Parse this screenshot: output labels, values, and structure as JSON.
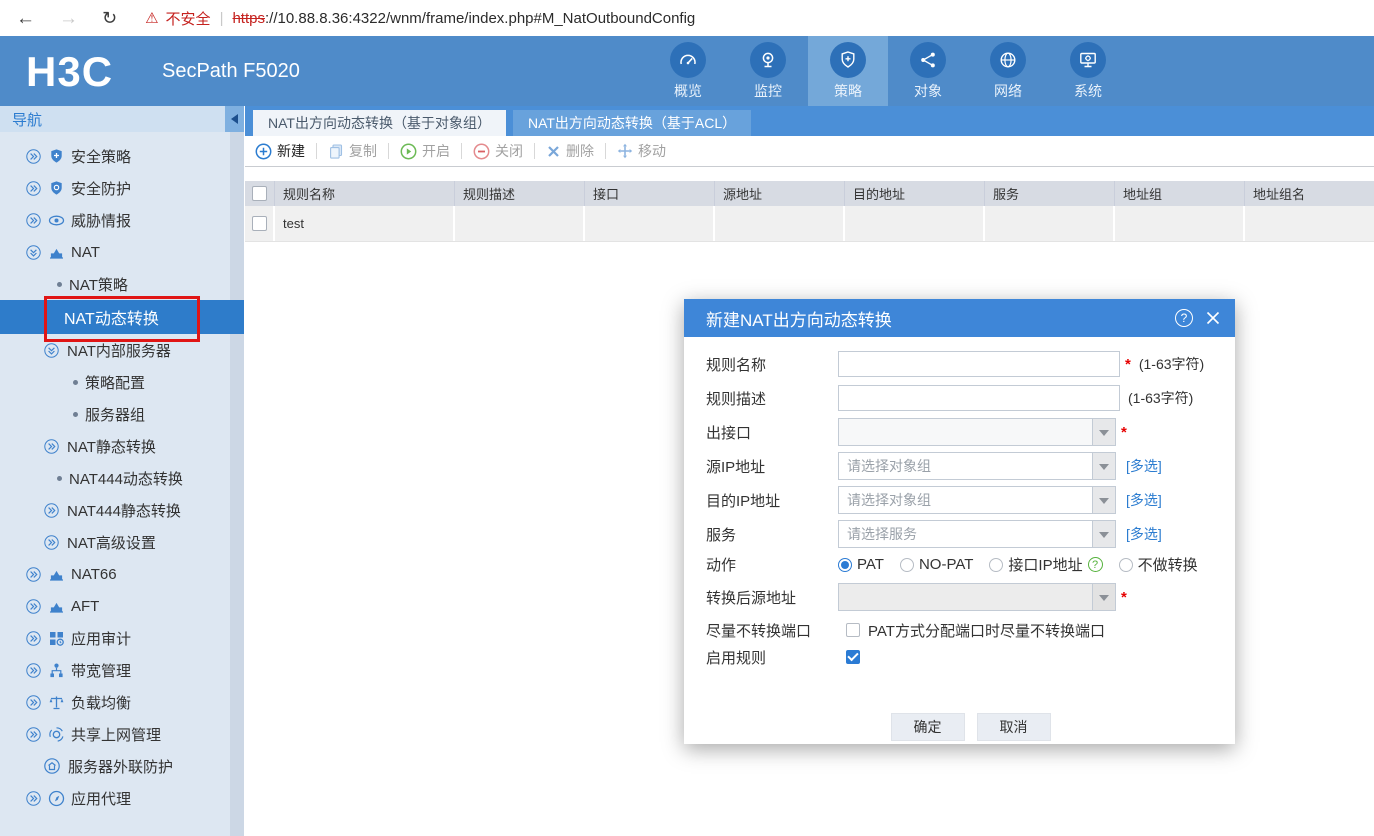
{
  "browser": {
    "back_icon": "←",
    "forward_icon": "→",
    "reload_icon": "↻",
    "warning_icon": "⚠",
    "warning_text": "不安全",
    "divider": "|",
    "url_scheme": "https",
    "url_rest": "://10.88.8.36:4322/wnm/frame/index.php#M_NatOutboundConfig"
  },
  "header": {
    "logo": "H3C",
    "product": "SecPath F5020",
    "nav": [
      {
        "label": "概览"
      },
      {
        "label": "监控"
      },
      {
        "label": "策略"
      },
      {
        "label": "对象"
      },
      {
        "label": "网络"
      },
      {
        "label": "系统"
      }
    ]
  },
  "sidebar": {
    "title": "导航",
    "items": [
      {
        "label": "安全策略"
      },
      {
        "label": "安全防护"
      },
      {
        "label": "威胁情报"
      },
      {
        "label": "NAT"
      },
      {
        "label": "NAT策略"
      },
      {
        "label": "NAT动态转换"
      },
      {
        "label": "NAT内部服务器"
      },
      {
        "label": "策略配置"
      },
      {
        "label": "服务器组"
      },
      {
        "label": "NAT静态转换"
      },
      {
        "label": "NAT444动态转换"
      },
      {
        "label": "NAT444静态转换"
      },
      {
        "label": "NAT高级设置"
      },
      {
        "label": "NAT66"
      },
      {
        "label": "AFT"
      },
      {
        "label": "应用审计"
      },
      {
        "label": "带宽管理"
      },
      {
        "label": "负载均衡"
      },
      {
        "label": "共享上网管理"
      },
      {
        "label": "服务器外联防护"
      },
      {
        "label": "应用代理"
      }
    ]
  },
  "tabs": [
    {
      "label": "NAT出方向动态转换（基于对象组）"
    },
    {
      "label": "NAT出方向动态转换（基于ACL）"
    }
  ],
  "toolbar": {
    "buttons": [
      {
        "label": "新建"
      },
      {
        "label": "复制"
      },
      {
        "label": "开启"
      },
      {
        "label": "关闭"
      },
      {
        "label": "删除"
      },
      {
        "label": "移动"
      }
    ]
  },
  "table": {
    "columns": [
      "规则名称",
      "规则描述",
      "接口",
      "源地址",
      "目的地址",
      "服务",
      "地址组",
      "地址组名"
    ],
    "rows": [
      {
        "name": "test"
      }
    ]
  },
  "modal": {
    "title": "新建NAT出方向动态转换",
    "help_icon": "?",
    "fields": {
      "name": {
        "label": "规则名称",
        "required": "*",
        "hint": "(1-63字符)"
      },
      "desc": {
        "label": "规则描述",
        "hint": "(1-63字符)"
      },
      "out_interface": {
        "label": "出接口",
        "required": "*"
      },
      "src_ip": {
        "label": "源IP地址",
        "placeholder": "请选择对象组",
        "multi": "[多选]"
      },
      "dst_ip": {
        "label": "目的IP地址",
        "placeholder": "请选择对象组",
        "multi": "[多选]"
      },
      "service": {
        "label": "服务",
        "placeholder": "请选择服务",
        "multi": "[多选]"
      },
      "action": {
        "label": "动作",
        "options": [
          "PAT",
          "NO-PAT",
          "接口IP地址",
          "不做转换"
        ],
        "help": "?",
        "selected": "PAT"
      },
      "translated_src": {
        "label": "转换后源地址",
        "required": "*"
      },
      "no_port_translate": {
        "label": "尽量不转换端口",
        "text": "PAT方式分配端口时尽量不转换端口",
        "checked": false
      },
      "enable_rule": {
        "label": "启用规则",
        "checked": true
      }
    },
    "ok_label": "确定",
    "cancel_label": "取消"
  },
  "colors": {
    "accent_blue": "#2b7cd0",
    "header_blue": "#4f8bc9",
    "selected_blue": "#2e7cca",
    "tabbar_blue": "#4b8fd7",
    "modal_title_blue": "#3e86d8",
    "annotation_red": "#e01515",
    "warning_red": "#c5221f",
    "help_green": "#55b23c"
  }
}
